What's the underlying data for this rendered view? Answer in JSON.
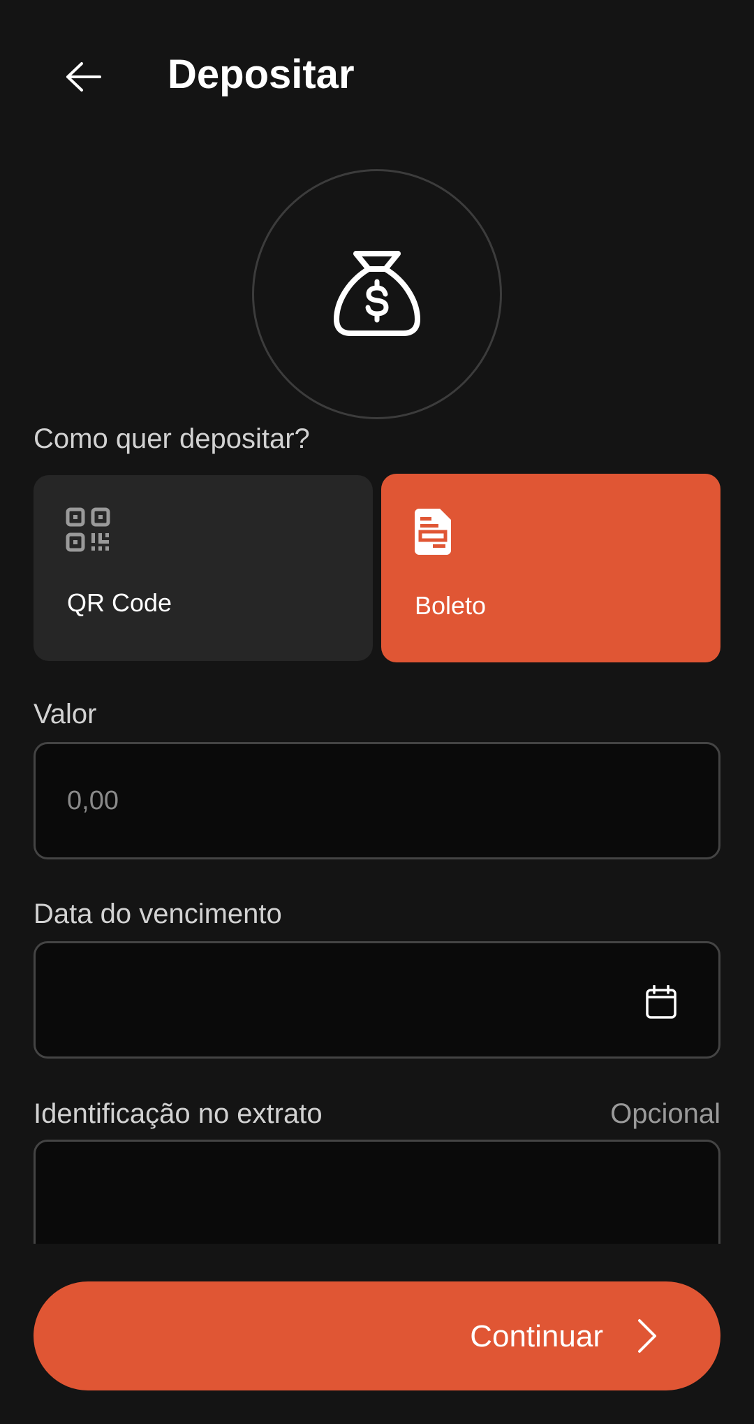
{
  "header": {
    "title": "Depositar",
    "back_icon": "arrow-left-icon"
  },
  "hero": {
    "icon": "money-bag-icon"
  },
  "method": {
    "question": "Como quer depositar?",
    "options": [
      {
        "label": "QR Code",
        "icon": "qr-code-icon",
        "selected": false
      },
      {
        "label": "Boleto",
        "icon": "document-icon",
        "selected": true
      }
    ]
  },
  "form": {
    "valor": {
      "label": "Valor",
      "placeholder": "0,00",
      "value": ""
    },
    "vencimento": {
      "label": "Data do vencimento",
      "value": "",
      "icon": "calendar-icon"
    },
    "identificacao": {
      "label": "Identificação no extrato",
      "hint": "Opcional",
      "value": ""
    }
  },
  "footer": {
    "continue_label": "Continuar",
    "continue_icon": "chevron-right-icon"
  },
  "colors": {
    "accent": "#e05634",
    "background": "#141414",
    "card": "#262626",
    "input_bg": "#0a0a0a",
    "input_border": "#444444"
  }
}
